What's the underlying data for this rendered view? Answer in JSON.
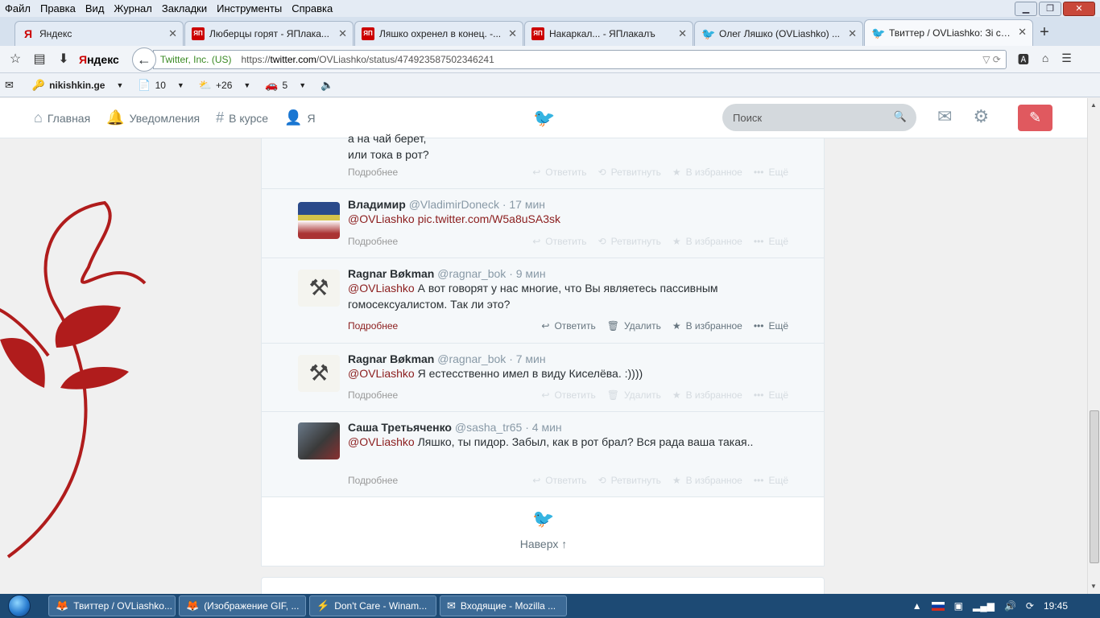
{
  "menubar": {
    "items": [
      "Файл",
      "Правка",
      "Вид",
      "Журнал",
      "Закладки",
      "Инструменты",
      "Справка"
    ]
  },
  "tabs": [
    {
      "icon": "yandex-icon",
      "label": "Яндекс"
    },
    {
      "icon": "yap-icon",
      "label": "Люберцы горят - ЯПлака..."
    },
    {
      "icon": "yap-icon",
      "label": "Ляшко охренел в конец. -..."
    },
    {
      "icon": "yap-icon",
      "label": "Накаркал... - ЯПлакалъ"
    },
    {
      "icon": "twitter-icon",
      "label": "Олег Ляшко (OVLiashko) ..."
    },
    {
      "icon": "twitter-icon",
      "label": "Твиттер / OVLiashko: Зі св..."
    }
  ],
  "navbar": {
    "yandex_logo_y": "Я",
    "yandex_logo_rest": "ндекс",
    "site_identity": "Twitter, Inc. (US)",
    "url_prefix": "https://",
    "url_domain": "twitter.com",
    "url_path": "/OVLiashko/status/474923587502346241"
  },
  "bookmarks": [
    {
      "label": "nikishkin.ge"
    },
    {
      "label": "10"
    },
    {
      "label": "+26"
    },
    {
      "label": "5"
    }
  ],
  "twitter_nav": {
    "home": "Главная",
    "notifications": "Уведомления",
    "discover": "В курсе",
    "me": "Я",
    "search_placeholder": "Поиск"
  },
  "tweets": [
    {
      "partial_text_1": "а на чай берет,",
      "partial_text_2": "или тока в рот?",
      "more": "Подробнее",
      "actions": [
        "Ответить",
        "Ретвитнуть",
        "В избранное",
        "Ещё"
      ]
    },
    {
      "name": "Владимир",
      "handle": "@VladimirDoneck",
      "time": "· 17 мин",
      "mention": "@OVLiashko",
      "text": "",
      "link": "pic.twitter.com/W5a8uSA3sk",
      "more": "Подробнее",
      "actions": [
        "Ответить",
        "Ретвитнуть",
        "В избранное",
        "Ещё"
      ]
    },
    {
      "name": "Ragnar Bøkman",
      "handle": "@ragnar_bok",
      "time": "· 9 мин",
      "mention": "@OVLiashko",
      "text": "А вот говорят у нас многие, что Вы являетесь пассивным гомосексуалистом. Так ли это?",
      "more": "Подробнее",
      "actions": [
        "Ответить",
        "Удалить",
        "В избранное",
        "Ещё"
      ]
    },
    {
      "name": "Ragnar Bøkman",
      "handle": "@ragnar_bok",
      "time": "· 7 мин",
      "mention": "@OVLiashko",
      "text": "Я естесственно имел в виду Киселёва. :))))",
      "more": "Подробнее",
      "actions": [
        "Ответить",
        "Удалить",
        "В избранное",
        "Ещё"
      ]
    },
    {
      "name": "Саша Третьяченко",
      "handle": "@sasha_tr65",
      "time": "· 4 мин",
      "mention": "@OVLiashko",
      "text": "Ляшко, ты пидор. Забыл, как в рот брал? Вся рада ваша такая..",
      "more": "Подробнее",
      "actions": [
        "Ответить",
        "Ретвитнуть",
        "В избранное",
        "Ещё"
      ]
    }
  ],
  "back_to_top": "Наверх ↑",
  "taskbar": {
    "items": [
      {
        "label": "Твиттер / OVLiashko..."
      },
      {
        "label": "(Изображение GIF, ..."
      },
      {
        "label": "Don't Care - Winam..."
      },
      {
        "label": "Входящие - Mozilla ..."
      }
    ],
    "clock": "19:45"
  },
  "colors": {
    "twitter_blue": "#55acee",
    "accent_red": "#8b1d1d",
    "compose": "#e0595f"
  }
}
